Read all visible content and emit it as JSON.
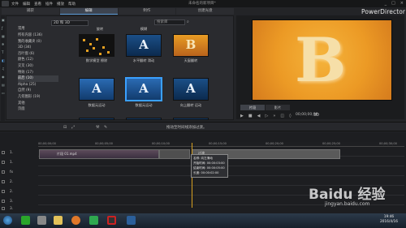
{
  "window": {
    "title": "未命名的新项目*",
    "menus": [
      "文件",
      "编辑",
      "查看",
      "插件",
      "播放",
      "帮助"
    ],
    "controls": [
      "_",
      "□",
      "×"
    ]
  },
  "tabs": [
    {
      "label": "捕获",
      "active": false
    },
    {
      "label": "编辑",
      "active": true
    },
    {
      "label": "制作",
      "active": false
    },
    {
      "label": "创建光盘",
      "active": false
    }
  ],
  "brand": "PowerDirector",
  "library": {
    "dropdown": "2D 和 3D",
    "search_placeholder": "搜索库",
    "tag_header": "常用",
    "categories": [
      {
        "label": "所有内容 (136)",
        "selected": false
      },
      {
        "label": "我的收藏夹 (0)",
        "selected": false
      },
      {
        "label": "3D (34)",
        "selected": false
      },
      {
        "label": "百叶窗 (6)",
        "selected": false
      },
      {
        "label": "颜色 (12)",
        "selected": false
      },
      {
        "label": "交叉 (30)",
        "selected": false
      },
      {
        "label": "特效 (17)",
        "selected": false
      },
      {
        "label": "前后 (10)",
        "selected": true
      },
      {
        "label": "Alpha (25)",
        "selected": false
      },
      {
        "label": "自然 (9)",
        "selected": false
      },
      {
        "label": "几何图形 (19)",
        "selected": false
      },
      {
        "label": "其他",
        "selected": false
      },
      {
        "label": "页面",
        "selected": false
      }
    ],
    "column_header": "旋转",
    "column_header_b": "模糊",
    "thumbnails": [
      {
        "caption": "数学模型 擦除",
        "letter": "",
        "style": "black"
      },
      {
        "caption": "水平翻转 滑动",
        "letter": "A",
        "style": "blue"
      },
      {
        "caption": "天窗翻转",
        "letter": "B",
        "style": "orange"
      },
      {
        "caption": "数据元运动",
        "letter": "A",
        "style": "blue2"
      },
      {
        "caption": "数据元运动",
        "letter": "A",
        "style": "blue2"
      },
      {
        "caption": "向上翻转 运动",
        "letter": "A",
        "style": "blue"
      }
    ]
  },
  "preview": {
    "letter": "B",
    "tabs": [
      {
        "label": "片段",
        "active": true
      },
      {
        "label": "影片",
        "active": false
      }
    ],
    "timecode": "00;00;00;00",
    "mode": "3D"
  },
  "midbar": {
    "hint": "拖动至时间线添加过渡。"
  },
  "timeline": {
    "ruler_ticks": [
      "00;00;00;00",
      "00;00;05;00",
      "00;00;10;00",
      "00;00;15;00",
      "00;00;20;00",
      "00;00;25;00",
      "00;00;30;00"
    ],
    "tracks": [
      "1.",
      "1.",
      "fx",
      "2.",
      "2.",
      "3.",
      "3."
    ],
    "clip_label": "片段 01.mp4",
    "transition_label": "过渡",
    "tooltip": [
      "名称: 向左滑动",
      "开始时间: 00:00:03:00",
      "结束时间: 00:00:05:00",
      "长度: 00:00:02:00"
    ]
  },
  "taskbar": {
    "time": "19:46",
    "date": "2016/4/16"
  },
  "watermark": {
    "main": "Baidu 经验",
    "sub": "jingyan.baidu.com"
  }
}
